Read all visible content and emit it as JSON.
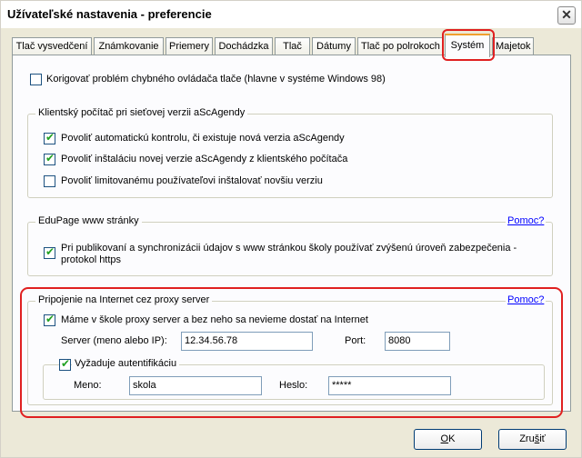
{
  "window": {
    "title": "Užívateľské nastavenia - preferencie",
    "close_symbol": "✕"
  },
  "tabs": [
    {
      "label": "Tlač vysvedčení"
    },
    {
      "label": "Známkovanie"
    },
    {
      "label": "Priemery"
    },
    {
      "label": "Dochádzka"
    },
    {
      "label": "Tlač"
    },
    {
      "label": "Dátumy"
    },
    {
      "label": "Tlač po polrokoch"
    },
    {
      "label": "Systém",
      "active": true
    },
    {
      "label": "Majetok"
    }
  ],
  "options": {
    "printer_fix": {
      "label": "Korigovať problém chybného ovládača tlače (hlavne v systéme Windows 98)",
      "checked": false
    }
  },
  "client_group": {
    "title": "Klientský počítač pri sieťovej verzii aScAgendy",
    "items": [
      {
        "label": "Povoliť automatickú kontrolu, či existuje nová verzia aScAgendy",
        "checked": true
      },
      {
        "label": "Povoliť inštaláciu novej verzie aScAgendy z klientského počítača",
        "checked": true
      },
      {
        "label": "Povoliť limitovanému používateľovi inštalovať novšiu verziu",
        "checked": false
      }
    ]
  },
  "edupage_group": {
    "title": "EduPage www stránky",
    "help": "Pomoc?",
    "https": {
      "label_line1": "Pri publikovaní a synchronizácii údajov s www stránkou školy používať zvýšenú úroveň zabezpečenia -",
      "label_line2": "protokol https",
      "checked": true
    }
  },
  "proxy_group": {
    "title": "Pripojenie na Internet cez proxy server",
    "help": "Pomoc?",
    "use_proxy": {
      "label": "Máme v škole proxy server a bez neho sa nevieme dostať na Internet",
      "checked": true
    },
    "server_label": "Server (meno alebo IP):",
    "server_value": "12.34.56.78",
    "port_label": "Port:",
    "port_value": "8080",
    "auth": {
      "label": "Vyžaduje autentifikáciu",
      "checked": true,
      "name_label": "Meno:",
      "name_value": "skola",
      "password_label": "Heslo:",
      "password_value": "*****"
    }
  },
  "buttons": {
    "ok": {
      "pre": "",
      "key": "O",
      "post": "K"
    },
    "cancel": {
      "pre": "Zru",
      "key": "š",
      "post": "iť"
    }
  },
  "colors": {
    "highlight": "#e02020",
    "link": "#0000ff",
    "check": "#21a121"
  }
}
